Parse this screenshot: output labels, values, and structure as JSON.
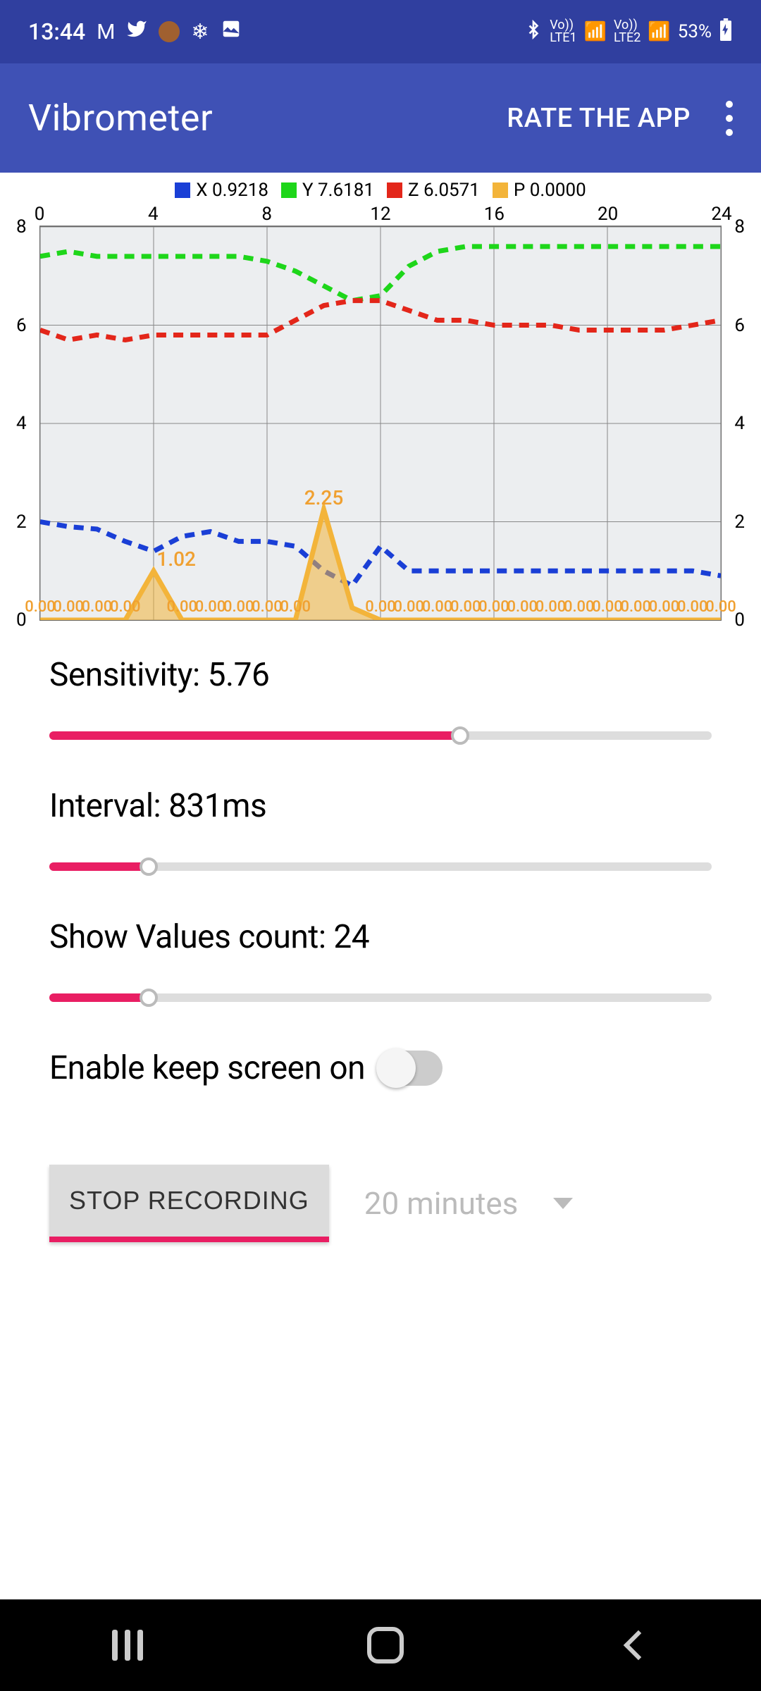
{
  "status": {
    "time": "13:44",
    "battery": "53%",
    "sim1": "LTE1",
    "sim2": "LTE2"
  },
  "app": {
    "title": "Vibrometer",
    "rate_label": "RATE THE APP"
  },
  "chart_data": {
    "type": "line",
    "xlabel": "",
    "ylabel": "",
    "xlim": [
      0,
      24
    ],
    "ylim": [
      0,
      8
    ],
    "x_ticks": [
      0,
      4,
      8,
      12,
      16,
      20,
      24
    ],
    "y_ticks": [
      0,
      2,
      4,
      6,
      8
    ],
    "legend": [
      {
        "name": "X",
        "value": "0.9218",
        "color": "#1a3fd6"
      },
      {
        "name": "Y",
        "value": "7.6181",
        "color": "#1ed61a"
      },
      {
        "name": "Z",
        "value": "6.0571",
        "color": "#e3261a"
      },
      {
        "name": "P",
        "value": "0.0000",
        "color": "#f3b43a"
      }
    ],
    "series": [
      {
        "name": "X",
        "color": "#1a3fd6",
        "style": "dashed",
        "values": [
          2.0,
          1.9,
          1.85,
          1.6,
          1.4,
          1.7,
          1.8,
          1.6,
          1.6,
          1.5,
          1.0,
          0.7,
          1.5,
          1.0,
          1.0,
          1.0,
          1.0,
          1.0,
          1.0,
          1.0,
          1.0,
          1.0,
          1.0,
          1.0,
          0.9
        ]
      },
      {
        "name": "Y",
        "color": "#1ed61a",
        "style": "dashed",
        "values": [
          7.4,
          7.5,
          7.4,
          7.4,
          7.4,
          7.4,
          7.4,
          7.4,
          7.3,
          7.1,
          6.8,
          6.5,
          6.6,
          7.2,
          7.5,
          7.6,
          7.6,
          7.6,
          7.6,
          7.6,
          7.6,
          7.6,
          7.6,
          7.6,
          7.6
        ]
      },
      {
        "name": "Z",
        "color": "#e3261a",
        "style": "dashed",
        "values": [
          5.9,
          5.7,
          5.8,
          5.7,
          5.8,
          5.8,
          5.8,
          5.8,
          5.8,
          6.1,
          6.4,
          6.5,
          6.5,
          6.3,
          6.1,
          6.1,
          6.0,
          6.0,
          6.0,
          5.9,
          5.9,
          5.9,
          5.9,
          6.0,
          6.1
        ]
      },
      {
        "name": "P",
        "color": "#f3b43a",
        "style": "solid-fill",
        "values": [
          0,
          0,
          0,
          0,
          1.0,
          0,
          0,
          0,
          0,
          0,
          2.25,
          0.25,
          0,
          0,
          0,
          0,
          0,
          0,
          0,
          0,
          0,
          0,
          0,
          0,
          0
        ]
      }
    ],
    "annotations": [
      {
        "x": 10,
        "y": 2.25,
        "text": "2.25"
      },
      {
        "x": 4.8,
        "y": 1.0,
        "text": "1.02"
      }
    ],
    "p_axis_labels": "0.00"
  },
  "settings": {
    "sensitivity": {
      "label_prefix": "Sensitivity: ",
      "value": "5.76",
      "fraction": 0.62
    },
    "interval": {
      "label_prefix": "Interval: ",
      "value": "831ms",
      "fraction": 0.15
    },
    "valuescount": {
      "label_prefix": "Show Values count: ",
      "value": "24",
      "fraction": 0.15
    },
    "keepscreen": {
      "label": "Enable keep screen on",
      "on": false
    }
  },
  "recording": {
    "button_label": "STOP RECORDING",
    "duration": "20 minutes"
  },
  "colors": {
    "primary": "#3f51b5",
    "primary_dark": "#303f9f",
    "accent": "#e91e63"
  }
}
